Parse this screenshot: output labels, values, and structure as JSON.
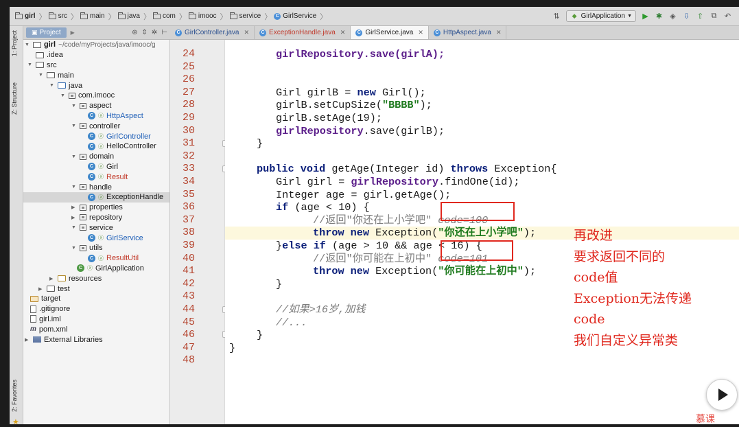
{
  "breadcrumb": [
    "girl",
    "src",
    "main",
    "java",
    "com",
    "imooc",
    "service",
    "GirlService"
  ],
  "run_config": "GirlApplication",
  "project_panel": {
    "tab_label": "Project"
  },
  "side_tabs": {
    "project": "1: Project",
    "structure": "Z: Structure",
    "favorites": "2: Favorites"
  },
  "editor_tabs": [
    {
      "label": "GirlController.java",
      "state": "normal"
    },
    {
      "label": "ExceptionHandle.java",
      "state": "error"
    },
    {
      "label": "GirlService.java",
      "state": "active"
    },
    {
      "label": "HttpAspect.java",
      "state": "normal"
    }
  ],
  "tree": {
    "root_name": "girl",
    "root_path": "~/code/myProjects/java/imooc/g",
    "items": [
      {
        "label": ".idea"
      },
      {
        "label": "src"
      },
      {
        "label": "main"
      },
      {
        "label": "java"
      },
      {
        "label": "com.imooc"
      },
      {
        "label": "aspect"
      },
      {
        "label": "HttpAspect"
      },
      {
        "label": "controller"
      },
      {
        "label": "GirlController"
      },
      {
        "label": "HelloController"
      },
      {
        "label": "domain"
      },
      {
        "label": "Girl"
      },
      {
        "label": "Result"
      },
      {
        "label": "handle"
      },
      {
        "label": "ExceptionHandle"
      },
      {
        "label": "properties"
      },
      {
        "label": "repository"
      },
      {
        "label": "service"
      },
      {
        "label": "GirlService"
      },
      {
        "label": "utils"
      },
      {
        "label": "ResultUtil"
      },
      {
        "label": "GirlApplication"
      },
      {
        "label": "resources"
      },
      {
        "label": "test"
      },
      {
        "label": "target"
      },
      {
        "label": ".gitignore"
      },
      {
        "label": "girl.iml"
      },
      {
        "label": "pom.xml"
      },
      {
        "label": "External Libraries"
      }
    ]
  },
  "code": {
    "line_numbers": [
      "24",
      "25",
      "26",
      "27",
      "28",
      "29",
      "30",
      "31",
      "32",
      "33",
      "34",
      "35",
      "36",
      "37",
      "38",
      "39",
      "40",
      "41",
      "42",
      "43",
      "44",
      "45",
      "46",
      "47",
      "48"
    ],
    "l24": "girlRepository.save(girlA);",
    "l27a": "Girl girlB = ",
    "l27b": "new",
    "l27c": " Girl();",
    "l28a": "girlB.setCupSize(",
    "l28b": "\"BBBB\"",
    "l28c": ");",
    "l29": "girlB.setAge(19);",
    "l30a": "girlRepository",
    "l30b": ".save(girlB);",
    "l31": "}",
    "l33a": "public void",
    "l33b": " getAge(Integer id) ",
    "l33c": "throws",
    "l33d": " Exception{",
    "l34a": "Girl girl = ",
    "l34b": "girlRepository",
    "l34c": ".findOne(id);",
    "l35": "Integer age = girl.getAge();",
    "l36a": "if",
    "l36b": " (age < 10) {",
    "l37a": "//返回\"你还在上小学吧\" ",
    "l37b": "code=100",
    "l38a": "throw new",
    "l38b": " Exception(",
    "l38c": "\"你还在上小学吧\"",
    "l38d": ");",
    "l39a": "}",
    "l39b": "else if",
    "l39c": " (age > 10 && age < 16) {",
    "l40a": "//返回\"你可能在上初中\" ",
    "l40b": "code=101",
    "l41a": "throw new",
    "l41b": " Exception(",
    "l41c": "\"你可能在上初中\"",
    "l41d": ");",
    "l42": "}",
    "l44": "//如果>16岁,加钱",
    "l45": "//...",
    "l46": "}",
    "l47": "}"
  },
  "annotation": [
    "再改进",
    "要求返回不同的",
    "code值",
    "Exception无法传递",
    "code",
    "我们自定义异常类"
  ],
  "watermark": "慕课"
}
